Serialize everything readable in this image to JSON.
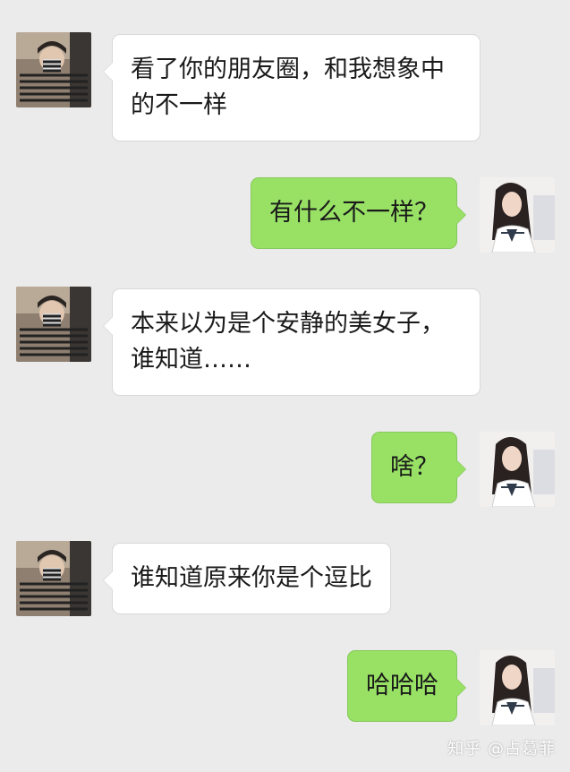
{
  "conversation": {
    "messages": [
      {
        "side": "in",
        "text": "看了你的朋友圈，和我想象中\n的不一样",
        "avatar": "boy-avatar"
      },
      {
        "side": "out",
        "text": "有什么不一样？",
        "avatar": "girl-avatar"
      },
      {
        "side": "in",
        "text": "本来以为是个安静的美女子，\n谁知道……",
        "avatar": "boy-avatar"
      },
      {
        "side": "out",
        "text": "啥？",
        "avatar": "girl-avatar"
      },
      {
        "side": "in",
        "text": "谁知道原来你是个逗比",
        "avatar": "boy-avatar"
      },
      {
        "side": "out",
        "text": "哈哈哈",
        "avatar": "girl-avatar"
      }
    ]
  },
  "watermark": {
    "text": "知乎 @占葛菲"
  },
  "colors": {
    "background": "#ebebeb",
    "incoming_bubble": "#ffffff",
    "outgoing_bubble": "#98e165"
  }
}
